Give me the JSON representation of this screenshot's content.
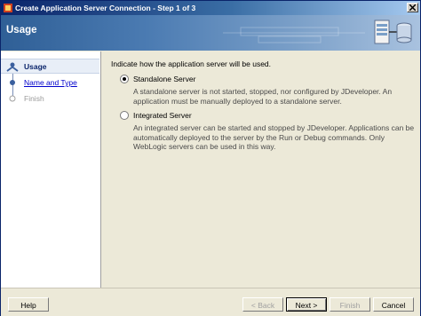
{
  "window": {
    "title": "Create Application Server Connection - Step 1 of 3"
  },
  "header": {
    "page_title": "Usage"
  },
  "nav": {
    "steps": [
      {
        "label": "Usage",
        "state": "active"
      },
      {
        "label": "Name and Type",
        "state": "link"
      },
      {
        "label": "Finish",
        "state": "disabled"
      }
    ]
  },
  "content": {
    "instruction": "Indicate how the application server will be used.",
    "options": [
      {
        "label": "Standalone Server",
        "checked": true,
        "description": "A standalone server is not started, stopped, nor configured by JDeveloper. An application must be manually deployed to a standalone server."
      },
      {
        "label": "Integrated Server",
        "checked": false,
        "description": "An integrated server can be started and stopped by JDeveloper. Applications can be automatically deployed to the server by the Run or Debug commands. Only WebLogic servers can be used in this way."
      }
    ]
  },
  "footer": {
    "help": "Help",
    "back": "< Back",
    "next": "Next >",
    "finish": "Finish",
    "cancel": "Cancel"
  },
  "colors": {
    "title_bar": "#0a246a",
    "header_gradient_start": "#2f5f96",
    "nav_background": "#ffffff",
    "dialog_background": "#ece9d8",
    "link": "#0000cc"
  }
}
